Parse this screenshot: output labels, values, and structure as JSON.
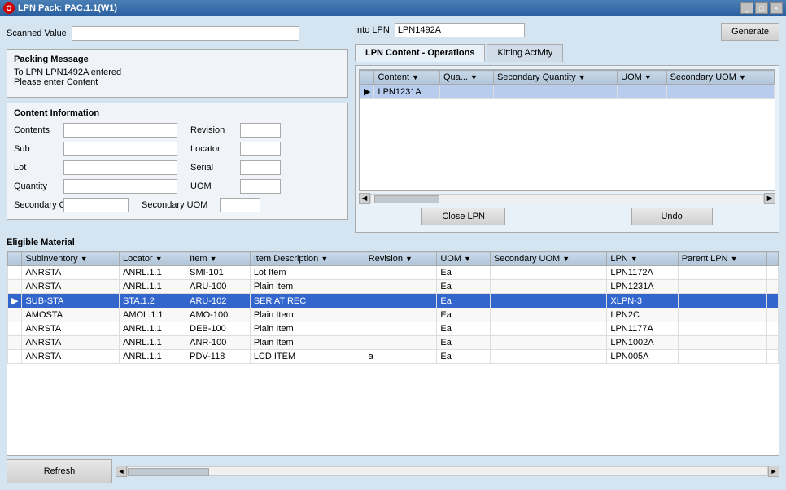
{
  "titleBar": {
    "title": "LPN Pack: PAC.1.1(W1)",
    "icon": "O"
  },
  "form": {
    "scannedValue": {
      "label": "Scanned Value",
      "value": ""
    },
    "packingMessage": {
      "title": "Packing Message",
      "line1": "To LPN LPN1492A entered",
      "line2": "Please enter Content"
    },
    "intoLPN": {
      "label": "Into LPN",
      "value": "LPN1492A"
    },
    "contentInfo": {
      "title": "Content Information",
      "contents": {
        "label": "Contents",
        "value": ""
      },
      "revision": {
        "label": "Revision",
        "value": ""
      },
      "sub": {
        "label": "Sub",
        "value": ""
      },
      "locator": {
        "label": "Locator",
        "value": ""
      },
      "lot": {
        "label": "Lot",
        "value": ""
      },
      "serial": {
        "label": "Serial",
        "value": ""
      },
      "quantity": {
        "label": "Quantity",
        "value": ""
      },
      "uom": {
        "label": "UOM",
        "value": ""
      },
      "secondaryQty": {
        "label": "Secondary Qty",
        "value": ""
      },
      "secondaryUOM": {
        "label": "Secondary UOM",
        "value": ""
      }
    }
  },
  "tabs": {
    "active": "lpn-content",
    "items": [
      {
        "id": "lpn-content",
        "label": "LPN Content - Operations"
      },
      {
        "id": "kitting",
        "label": "Kitting Activity"
      }
    ]
  },
  "generateButton": "Generate",
  "lpnContentTable": {
    "columns": [
      "Content",
      "Qua...",
      "Secondary Quantity",
      "UOM",
      "Secondary UOM"
    ],
    "rows": [
      {
        "selected": true,
        "dot": true,
        "content": "LPN1231A",
        "quantity": "",
        "secondaryQty": "",
        "uom": "",
        "secondaryUOM": ""
      }
    ]
  },
  "buttons": {
    "closeLPN": "Close LPN",
    "undo": "Undo"
  },
  "eligibleMaterial": {
    "title": "Eligible Material",
    "columns": [
      "Subinventory",
      "Locator",
      "Item",
      "Item Description",
      "Revision",
      "UOM",
      "Secondary UOM",
      "LPN",
      "Parent LPN"
    ],
    "rows": [
      {
        "subinventory": "ANRSTA",
        "locator": "ANRL.1.1",
        "item": "SMI-101",
        "description": "Lot Item",
        "revision": "",
        "uom": "Ea",
        "secondaryUOM": "",
        "lpn": "LPN1172A",
        "parentLPN": "",
        "selected": false
      },
      {
        "subinventory": "ANRSTA",
        "locator": "ANRL.1.1",
        "item": "ARU-100",
        "description": "Plain item",
        "revision": "",
        "uom": "Ea",
        "secondaryUOM": "",
        "lpn": "LPN1231A",
        "parentLPN": "",
        "selected": false
      },
      {
        "subinventory": "SUB-STA",
        "locator": "STA.1.2",
        "item": "ARU-102",
        "description": "SER AT REC",
        "revision": "",
        "uom": "Ea",
        "secondaryUOM": "",
        "lpn": "XLPN-3",
        "parentLPN": "",
        "selected": true
      },
      {
        "subinventory": "AMOSTA",
        "locator": "AMOL.1.1",
        "item": "AMO-100",
        "description": "Plain Item",
        "revision": "",
        "uom": "Ea",
        "secondaryUOM": "",
        "lpn": "LPN2C",
        "parentLPN": "",
        "selected": false
      },
      {
        "subinventory": "ANRSTA",
        "locator": "ANRL.1.1",
        "item": "DEB-100",
        "description": "Plain Item",
        "revision": "",
        "uom": "Ea",
        "secondaryUOM": "",
        "lpn": "LPN1177A",
        "parentLPN": "",
        "selected": false
      },
      {
        "subinventory": "ANRSTA",
        "locator": "ANRL.1.1",
        "item": "ANR-100",
        "description": "Plain Item",
        "revision": "",
        "uom": "Ea",
        "secondaryUOM": "",
        "lpn": "LPN1002A",
        "parentLPN": "",
        "selected": false
      },
      {
        "subinventory": "ANRSTA",
        "locator": "ANRL.1.1",
        "item": "PDV-118",
        "description": "LCD ITEM",
        "revision": "a",
        "uom": "Ea",
        "secondaryUOM": "",
        "lpn": "LPN005A",
        "parentLPN": "",
        "selected": false
      }
    ]
  },
  "refreshButton": "Refresh"
}
